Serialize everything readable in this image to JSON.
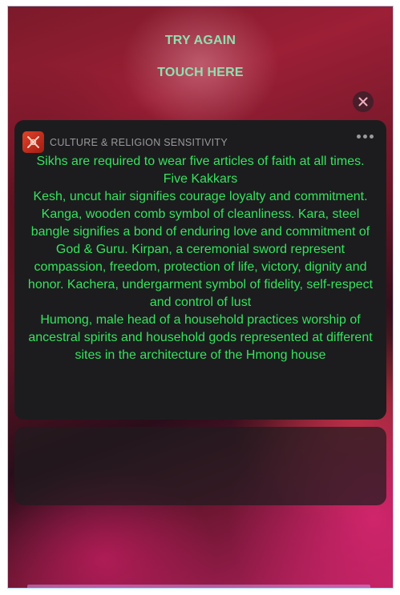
{
  "overlay": {
    "try_again": "TRY AGAIN",
    "touch_here": "TOUCH HERE"
  },
  "notification": {
    "app_name": "CULTURE & RELIGION SENSITIVITY",
    "app_icon": "culture-app-icon",
    "paragraphs": [
      "Sikhs are required to wear five articles of faith at all times. Five Kakkars",
      "Kesh, uncut hair signifies courage loyalty and commitment. Kanga, wooden comb symbol of cleanliness. Kara, steel bangle signifies a bond of enduring love and commitment of God & Guru. Kirpan, a ceremonial sword represent compassion, freedom, protection of life, victory, dignity and honor. Kachera, undergarment symbol of fidelity, self-respect and control of lust",
      "Humong, male head of a household practices  worship of  ancestral spirits and household gods represented at different sites in the architecture of the Hmong house"
    ]
  },
  "colors": {
    "body_text": "#37e25f",
    "overlay_text": "#8fe0b0",
    "card_bg": "#1c1c1e"
  }
}
